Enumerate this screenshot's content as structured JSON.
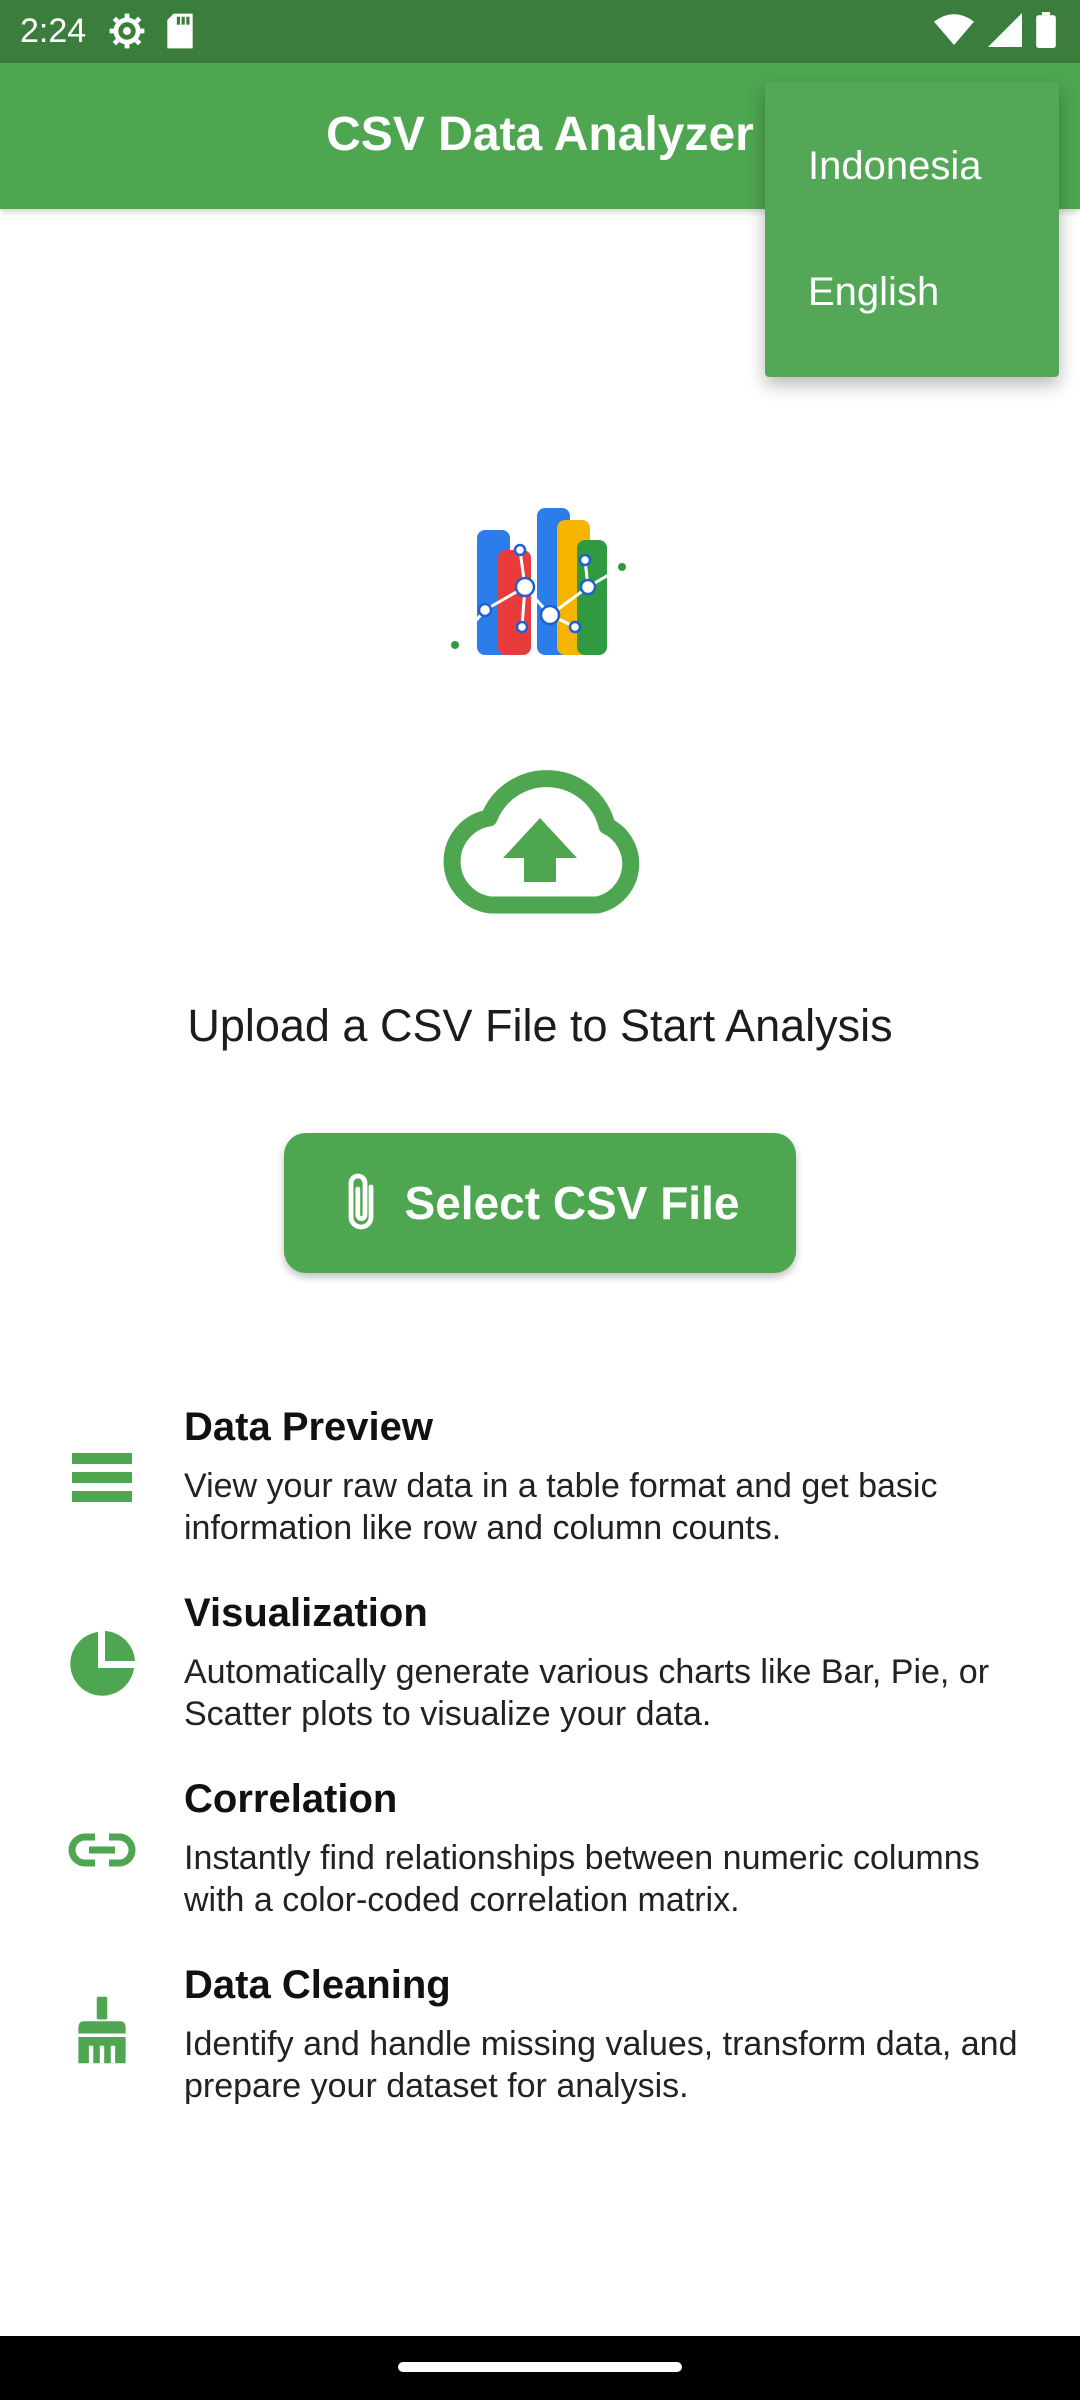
{
  "status_bar": {
    "time": "2:24",
    "icons_left": [
      "settings-icon",
      "sd-card-icon"
    ],
    "icons_right": [
      "wifi-icon",
      "signal-icon",
      "battery-icon"
    ]
  },
  "app_bar": {
    "title": "CSV Data Analyzer",
    "color": "#4ea651"
  },
  "language_menu": {
    "items": [
      "Indonesia",
      "English"
    ]
  },
  "upload": {
    "prompt": "Upload a CSV File to Start Analysis",
    "button_label": "Select CSV File",
    "button_icon": "paperclip-icon"
  },
  "features": [
    {
      "icon": "list-icon",
      "title": "Data Preview",
      "description": "View your raw data in a table format and get basic information like row and column counts."
    },
    {
      "icon": "pie-chart-icon",
      "title": "Visualization",
      "description": "Automatically generate various charts like Bar, Pie, or Scatter plots to visualize your data."
    },
    {
      "icon": "link-icon",
      "title": "Correlation",
      "description": "Instantly find relationships between numeric columns with a color-coded correlation matrix."
    },
    {
      "icon": "broom-icon",
      "title": "Data Cleaning",
      "description": "Identify and handle missing values, transform data, and prepare your dataset for analysis."
    }
  ],
  "colors": {
    "primary": "#4ea651",
    "status_bar": "#3a7d3c",
    "accent_icon": "#4ea651"
  }
}
